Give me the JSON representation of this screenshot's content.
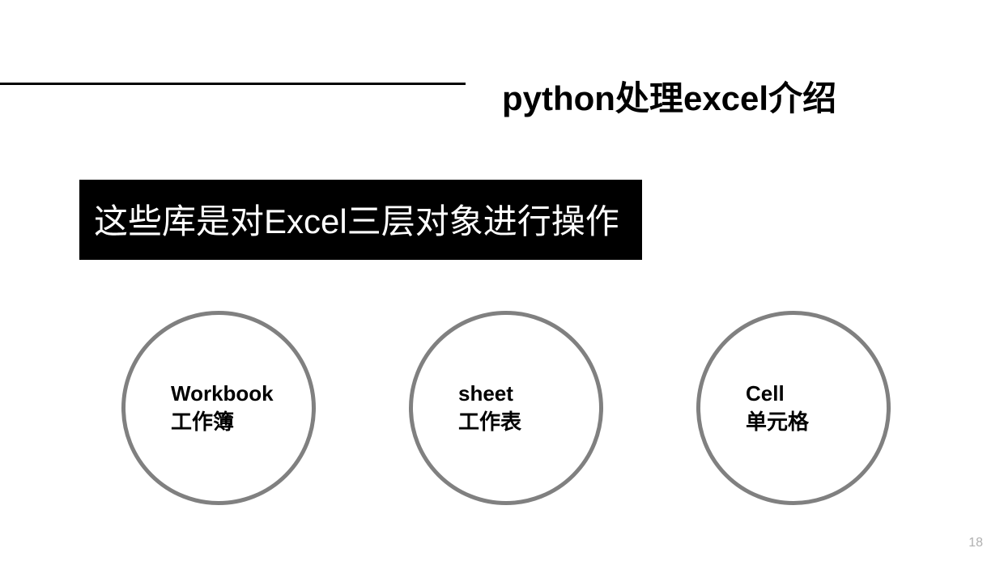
{
  "title": "python处理excel介绍",
  "subtitle": "这些库是对Excel三层对象进行操作",
  "circles": [
    {
      "en": "Workbook",
      "zh": "工作簿"
    },
    {
      "en": "sheet",
      "zh": "工作表"
    },
    {
      "en": "Cell",
      "zh": "单元格"
    }
  ],
  "page_number": "18"
}
